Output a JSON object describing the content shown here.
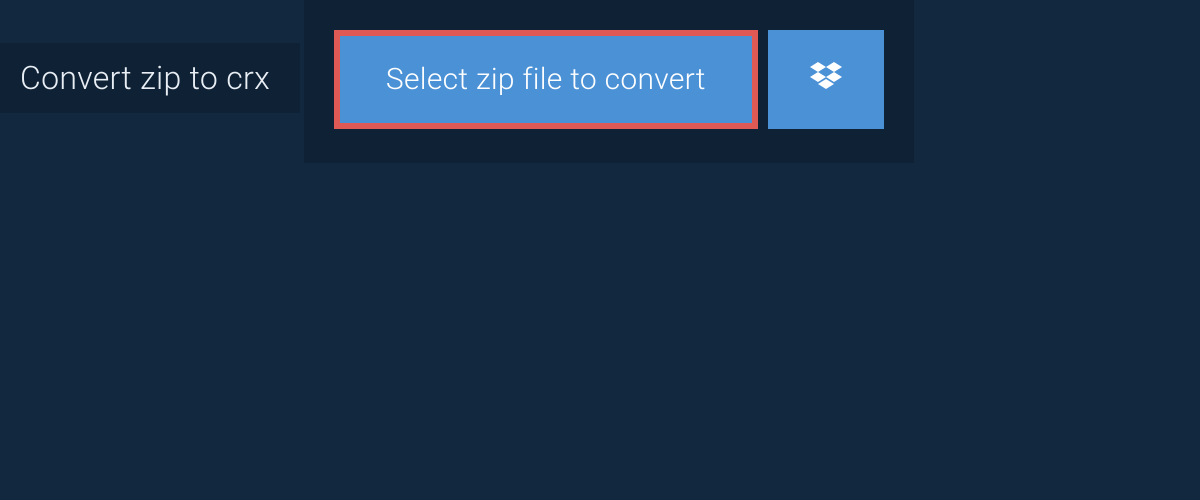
{
  "header": {
    "title": "Convert zip to crx"
  },
  "actions": {
    "select_file_label": "Select zip file to convert"
  },
  "colors": {
    "page_bg": "#12283e",
    "panel_bg": "#0e2135",
    "button_bg": "#4b91d6",
    "highlight_border": "#e05a55",
    "text": "#ffffff"
  }
}
